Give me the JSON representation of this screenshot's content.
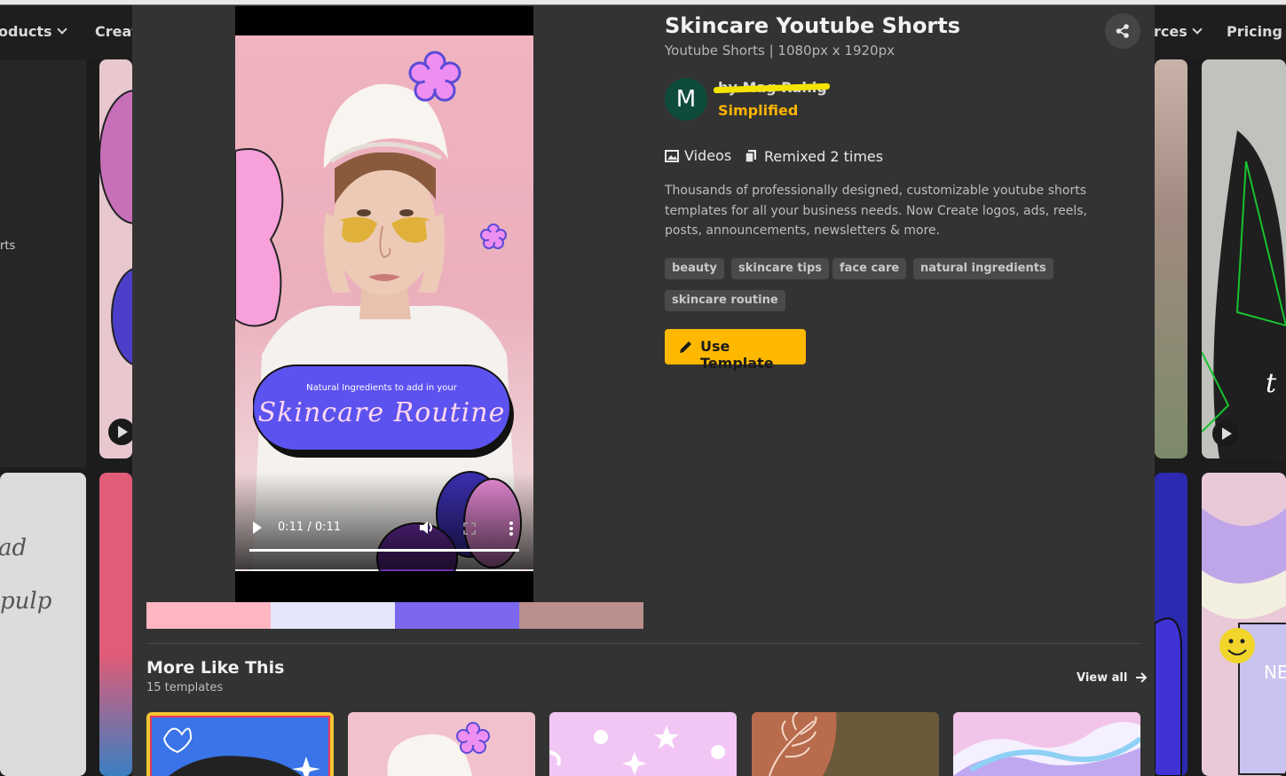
{
  "nav": {
    "products_label": "oducts",
    "create_label": "Creat",
    "resources_label": "rces",
    "pricing_label": "Pricing"
  },
  "background": {
    "side_text_1": "rts",
    "side_text_2": "ad",
    "side_text_3": "pulp"
  },
  "video": {
    "caption_small": "Natural Ingredients to add in your",
    "caption_script": "Skincare Routine",
    "time": "0:11 / 0:11",
    "progress": 1.0
  },
  "palette": [
    "#ffb6c1",
    "#e6e6fa",
    "#7b68ee",
    "#bc8f8f"
  ],
  "template": {
    "title": "Skincare Youtube Shorts",
    "subtitle": "Youtube Shorts | 1080px x 1920px",
    "avatar_letter": "M",
    "author": "by Mag Rahig",
    "brand": "Simplified",
    "category": "Videos",
    "remixed": "Remixed 2 times",
    "description": "Thousands of professionally designed, customizable youtube shorts templates for all your business needs. Now Create logos, ads, reels, posts, announcements, newsletters & more.",
    "tags": [
      "beauty",
      "skincare tips",
      "face care",
      "natural ingredients",
      "skincare routine"
    ],
    "use_button": "Use Template"
  },
  "more": {
    "title": "More Like This",
    "count": "15 templates",
    "view_all": "View all"
  },
  "colors": {
    "accent": "#ffb800",
    "modal_bg": "#333333",
    "brand_text": "#ffb400",
    "avatar_bg": "#0e4b3b",
    "highlight": "#f5e400"
  },
  "icons": [
    "chevron-down-icon",
    "share-icon",
    "image-icon",
    "copy-icon",
    "pencil-icon",
    "arrow-right-icon",
    "play-icon",
    "volume-icon",
    "fullscreen-icon",
    "more-vertical-icon"
  ]
}
